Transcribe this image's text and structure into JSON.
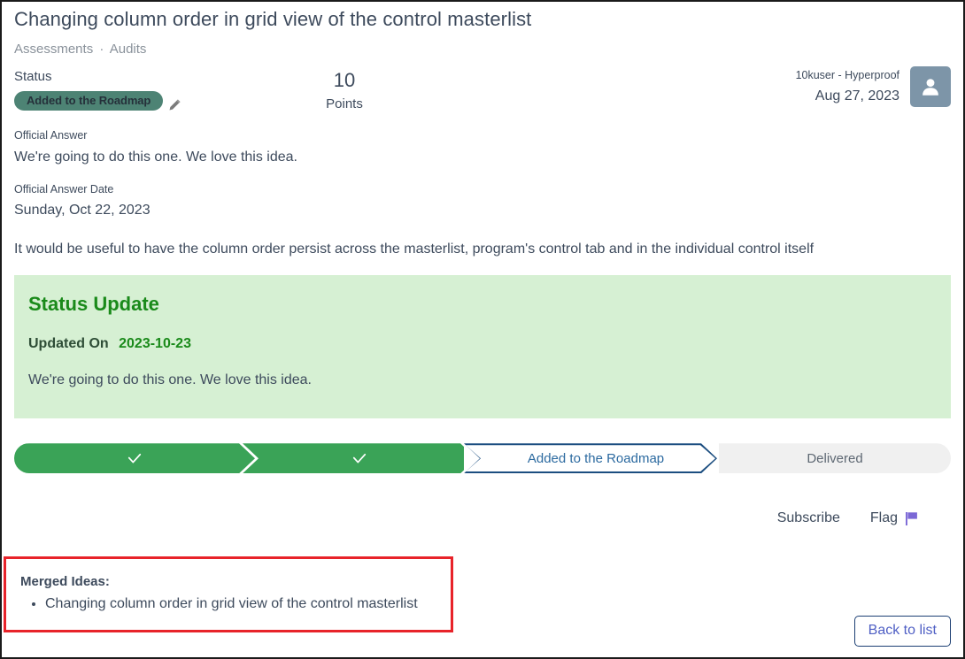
{
  "page": {
    "title": "Changing column order in grid view of the control masterlist",
    "breadcrumb": {
      "first": "Assessments",
      "separator": "·",
      "second": "Audits"
    }
  },
  "meta": {
    "status_label": "Status",
    "status_value": "Added to the Roadmap",
    "edit_icon": "pencil-icon",
    "points_value": "10",
    "points_label": "Points",
    "user_name": "10kuser - Hyperproof",
    "user_date": "Aug 27, 2023",
    "avatar_icon": "person-icon"
  },
  "official_answer": {
    "label": "Official Answer",
    "value": "We're going to do this one. We love this idea.",
    "date_label": "Official Answer Date",
    "date_value": "Sunday, Oct 22, 2023"
  },
  "description": "It would be useful to have the column order persist across the masterlist, program's control tab and in the individual control itself",
  "status_update": {
    "title": "Status Update",
    "updated_on_label": "Updated On",
    "updated_on_date": "2023-10-23",
    "body": "We're going to do this one. We love this idea."
  },
  "stepper": {
    "steps": [
      {
        "label": "",
        "state": "complete",
        "icon": "check-icon"
      },
      {
        "label": "",
        "state": "complete",
        "icon": "check-icon"
      },
      {
        "label": "Added to the Roadmap",
        "state": "current",
        "icon": ""
      },
      {
        "label": "Delivered",
        "state": "upcoming",
        "icon": ""
      }
    ]
  },
  "actions": {
    "subscribe": "Subscribe",
    "flag": "Flag",
    "flag_icon": "flag-icon"
  },
  "merged": {
    "title": "Merged Ideas:",
    "items": [
      "Changing column order in grid view of the control masterlist"
    ]
  },
  "footer": {
    "back_label": "Back to list"
  },
  "colors": {
    "text": "#3d4a5c",
    "muted": "#8a929b",
    "status_pill_bg": "#4d8374",
    "step_complete": "#3aa357",
    "step_current_border": "#1c4e80",
    "step_current_text": "#2c6aa0",
    "step_upcoming_bg": "#f0f0f0",
    "status_card_bg": "#d6f0d3",
    "status_card_green": "#1a8a1a",
    "highlight_border": "#e8232a",
    "avatar_bg": "#7d95a8",
    "flag_purple": "#7b68d6",
    "link_blue": "#4f5fc4"
  }
}
